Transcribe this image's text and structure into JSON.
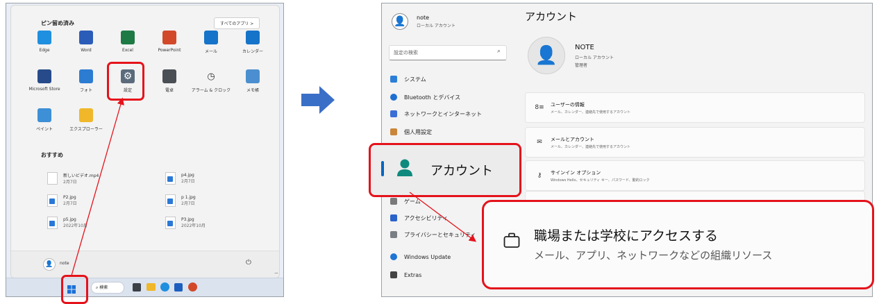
{
  "start": {
    "pinned_label": "ピン留め済み",
    "all_apps": "すべてのアプリ  >",
    "apps": [
      {
        "label": "Edge",
        "icon": "edge-icon",
        "color": "#1f8fe0"
      },
      {
        "label": "Word",
        "icon": "word-icon",
        "color": "#2b5cb8"
      },
      {
        "label": "Excel",
        "icon": "excel-icon",
        "color": "#1d7a45"
      },
      {
        "label": "PowerPoint",
        "icon": "powerpoint-icon",
        "color": "#d2492a"
      },
      {
        "label": "メール",
        "icon": "mail-icon",
        "color": "#1573c9"
      },
      {
        "label": "カレンダー",
        "icon": "calendar-icon",
        "color": "#1573c9"
      },
      {
        "label": "Microsoft Store",
        "icon": "store-icon",
        "color": "#274b8a"
      },
      {
        "label": "フォト",
        "icon": "photos-icon",
        "color": "#2c7cd1"
      },
      {
        "label": "設定",
        "icon": "gear-icon",
        "color": "#5b6b7c"
      },
      {
        "label": "電卓",
        "icon": "calculator-icon",
        "color": "#4a4f55"
      },
      {
        "label": "アラーム & クロック",
        "icon": "clock-icon",
        "color": "#3a4a5a"
      },
      {
        "label": "メモ帳",
        "icon": "notepad-icon",
        "color": "#4b8fd0"
      },
      {
        "label": "ペイント",
        "icon": "paint-icon",
        "color": "#3d8fd6"
      },
      {
        "label": "エクスプローラー",
        "icon": "folder-icon",
        "color": "#f0b72a"
      }
    ],
    "recommended_label": "おすすめ",
    "recommended": [
      {
        "name": "新しいビデオ.mp4",
        "date": "2月7日"
      },
      {
        "name": "p4.jpg",
        "date": "2月7日"
      },
      {
        "name": "P2.jpg",
        "date": "2月7日"
      },
      {
        "name": "p 1.jpg",
        "date": "2月7日"
      },
      {
        "name": "p5.jpg",
        "date": "2022年10月"
      },
      {
        "name": "P3.jpg",
        "date": "2022年10月"
      }
    ],
    "user_name": "note",
    "search_label": "検索"
  },
  "settings": {
    "user_name": "note",
    "user_sub": "ローカル アカウント",
    "search_placeholder": "設定の検索",
    "nav": [
      {
        "label": "システム",
        "color": "#2c7fd8"
      },
      {
        "label": "Bluetooth とデバイス",
        "color": "#1e6fd1"
      },
      {
        "label": "ネットワークとインターネット",
        "color": "#3a6fd8"
      },
      {
        "label": "個人用設定",
        "color": "#c9863a"
      },
      {
        "label": "ゲーム",
        "color": "#7a7a7a"
      },
      {
        "label": "アクセシビリティ",
        "color": "#2a63c9"
      },
      {
        "label": "プライバシーとセキュリティ",
        "color": "#7a7f85"
      },
      {
        "label": "Windows Update",
        "color": "#1f74d4"
      },
      {
        "label": "Extras",
        "color": "#444444"
      }
    ],
    "page_title": "アカウント",
    "profile_name": "NOTE",
    "profile_sub": "ローカル アカウント",
    "profile_role": "管理者",
    "cards": [
      {
        "title": "ユーザーの情報",
        "sub": "メール、カレンダー、連絡先で使用するアカウント",
        "icon": "user-info-icon",
        "glyph": "8≡"
      },
      {
        "title": "メールとアカウント",
        "sub": "メール、カレンダー、連絡先で使用するアカウント",
        "icon": "mail-icon",
        "glyph": "✉"
      },
      {
        "title": "サインイン オプション",
        "sub": "Windows Hello、セキュリティ キー、パスワード、動的ロック",
        "icon": "key-icon",
        "glyph": "⚷"
      }
    ]
  },
  "callouts": {
    "accounts_label": "アカウント",
    "work_title": "職場または学校にアクセスする",
    "work_sub": "メール、アプリ、ネットワークなどの組織リソース"
  },
  "colors": {
    "highlight": "#e5121b",
    "arrow": "#3a6fc7",
    "accent": "#0067c0"
  }
}
